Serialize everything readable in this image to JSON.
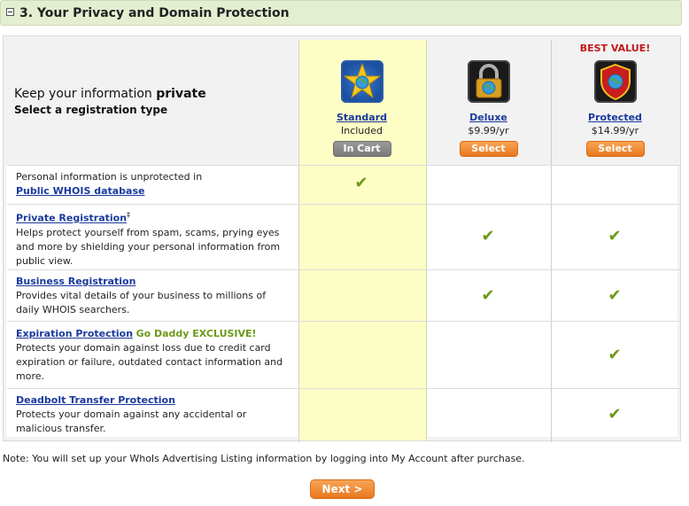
{
  "section": {
    "title": "3. Your Privacy and Domain Protection"
  },
  "intro": {
    "line1_prefix": "Keep your information ",
    "line1_bold": "private",
    "line2": "Select a registration type"
  },
  "plans": [
    {
      "best": "",
      "name": "Standard",
      "price": "Included",
      "button": "In Cart",
      "icon": "star-globe-icon"
    },
    {
      "best": "",
      "name": "Deluxe",
      "price": "$9.99/yr",
      "button": "Select",
      "icon": "padlock-globe-icon"
    },
    {
      "best": "BEST VALUE!",
      "name": "Protected",
      "price": "$14.99/yr",
      "button": "Select",
      "icon": "shield-globe-icon"
    }
  ],
  "features": [
    {
      "name": "",
      "pre": "Personal information is unprotected in",
      "link": "Public WHOIS database",
      "extra": "",
      "desc": "",
      "checks": [
        true,
        false,
        false
      ]
    },
    {
      "name": "Private Registration",
      "sup": "‡",
      "extra": "",
      "desc": "Helps protect yourself from spam, scams, prying eyes and more by shielding your personal information from public view.",
      "checks": [
        false,
        true,
        true
      ]
    },
    {
      "name": "Business Registration",
      "extra": "",
      "desc": "Provides vital details of your business to millions of daily WHOIS searchers.",
      "checks": [
        false,
        true,
        true
      ]
    },
    {
      "name": "Expiration Protection",
      "extra": "Go Daddy EXCLUSIVE!",
      "desc": "Protects your domain against loss due to credit card expiration or failure, outdated contact information and more.",
      "checks": [
        false,
        false,
        true
      ]
    },
    {
      "name": "Deadbolt Transfer Protection",
      "extra": "",
      "desc": "Protects your domain against any accidental or malicious transfer.",
      "checks": [
        false,
        false,
        true
      ]
    }
  ],
  "check_glyph": "✔",
  "note": "Note: You will set up your WhoIs Advertising Listing information by logging into My Account after purchase.",
  "next_button": "Next >",
  "colors": {
    "accent_orange": "#e8781e",
    "check_green": "#6b9a14",
    "link_blue": "#1a3a9c",
    "best_value_red": "#c21a1a",
    "standard_highlight": "#fdfdc6"
  }
}
